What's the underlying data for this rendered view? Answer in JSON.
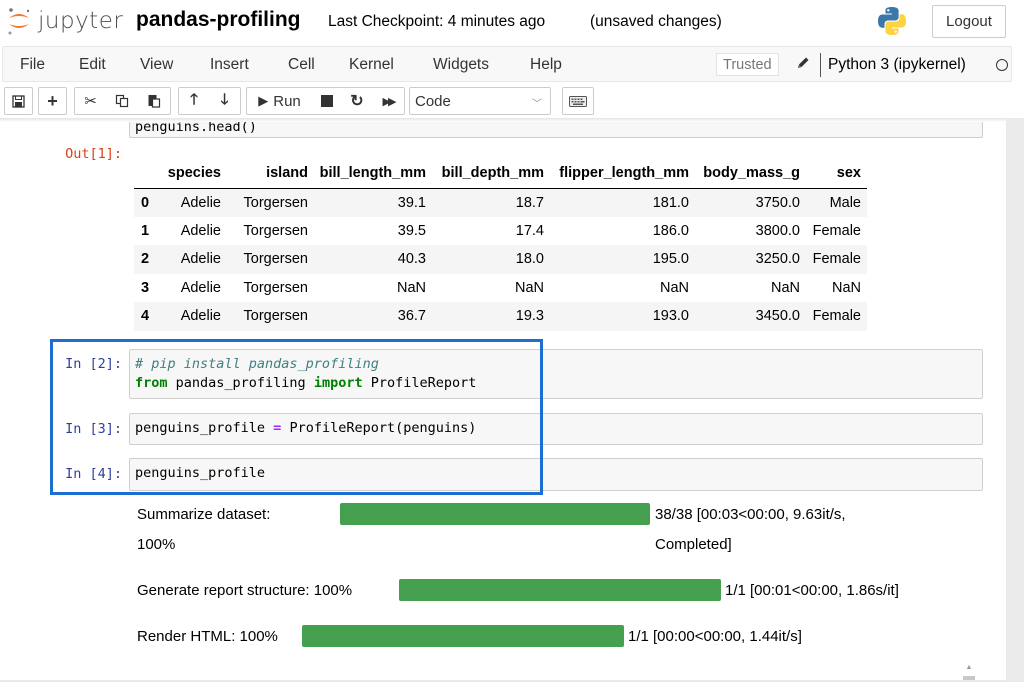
{
  "header": {
    "logo_text": "jupyter",
    "notebook_title": "pandas-profiling",
    "checkpoint": "Last Checkpoint: 4 minutes ago",
    "save_status": "(unsaved changes)",
    "logout_label": "Logout"
  },
  "menubar": {
    "items": [
      "File",
      "Edit",
      "View",
      "Insert",
      "Cell",
      "Kernel",
      "Widgets",
      "Help"
    ],
    "trusted_label": "Trusted",
    "kernel_name": "Python 3 (ipykernel)"
  },
  "toolbar": {
    "run_label": "Run",
    "cell_type": "Code"
  },
  "cells": [
    {
      "prompt": "",
      "code_visible": "penguins.head()"
    },
    {
      "out_prompt": "Out[1]:",
      "dataframe": {
        "columns": [
          "",
          "species",
          "island",
          "bill_length_mm",
          "bill_depth_mm",
          "flipper_length_mm",
          "body_mass_g",
          "sex"
        ],
        "rows": [
          [
            "0",
            "Adelie",
            "Torgersen",
            "39.1",
            "18.7",
            "181.0",
            "3750.0",
            "Male"
          ],
          [
            "1",
            "Adelie",
            "Torgersen",
            "39.5",
            "17.4",
            "186.0",
            "3800.0",
            "Female"
          ],
          [
            "2",
            "Adelie",
            "Torgersen",
            "40.3",
            "18.0",
            "195.0",
            "3250.0",
            "Female"
          ],
          [
            "3",
            "Adelie",
            "Torgersen",
            "NaN",
            "NaN",
            "NaN",
            "NaN",
            "NaN"
          ],
          [
            "4",
            "Adelie",
            "Torgersen",
            "36.7",
            "19.3",
            "193.0",
            "3450.0",
            "Female"
          ]
        ]
      }
    },
    {
      "prompt": "In [2]:",
      "line1_comment": "# pip install pandas_profiling",
      "line2_kw1": "from",
      "line2_mod": " pandas_profiling ",
      "line2_kw2": "import",
      "line2_name": " ProfileReport"
    },
    {
      "prompt": "In [3]:",
      "lhs": "penguins_profile ",
      "op": "=",
      "rhs": " ProfileReport(penguins)"
    },
    {
      "prompt": "In [4]:",
      "code": "penguins_profile"
    }
  ],
  "progress": [
    {
      "label": "Summarize dataset:",
      "percent_text": "100%",
      "fraction": 1.0,
      "stats_line1": "38/38 [00:03<00:00, 9.63it/s,",
      "stats_line2": "Completed]"
    },
    {
      "label": "Generate report structure: 100%",
      "fraction": 1.0,
      "stats": "1/1 [00:01<00:00, 1.86s/it]"
    },
    {
      "label": "Render HTML: 100%",
      "fraction": 1.0,
      "stats": "1/1 [00:00<00:00, 1.44it/s]"
    }
  ],
  "colors": {
    "progress_fill": "#44a04f",
    "highlight_box": "#1c6fd0",
    "in_prompt": "#303f9f",
    "out_prompt": "#d84315"
  }
}
